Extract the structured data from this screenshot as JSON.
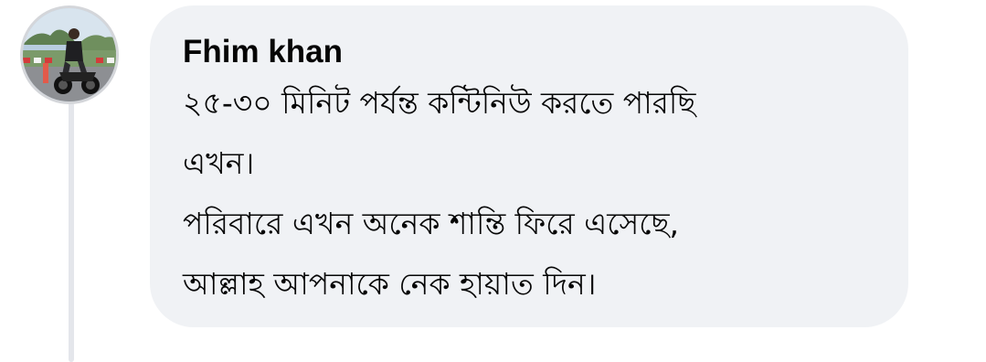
{
  "comment": {
    "author": "Fhim khan",
    "lines": [
      "২৫-৩০ মিনিট পর্যন্ত কন্টিনিউ করতে পারছি",
      "এখন।",
      "পরিবারে এখন অনেক শান্তি ফিরে এসেছে,",
      "আল্লাহ আপনাকে নেক হায়াত দিন।"
    ]
  },
  "colors": {
    "bubble_background": "#f0f2f5",
    "text": "#050505",
    "thread_line": "#e4e6eb"
  },
  "icons": {
    "avatar": "profile-photo-person-on-motorcycle"
  }
}
